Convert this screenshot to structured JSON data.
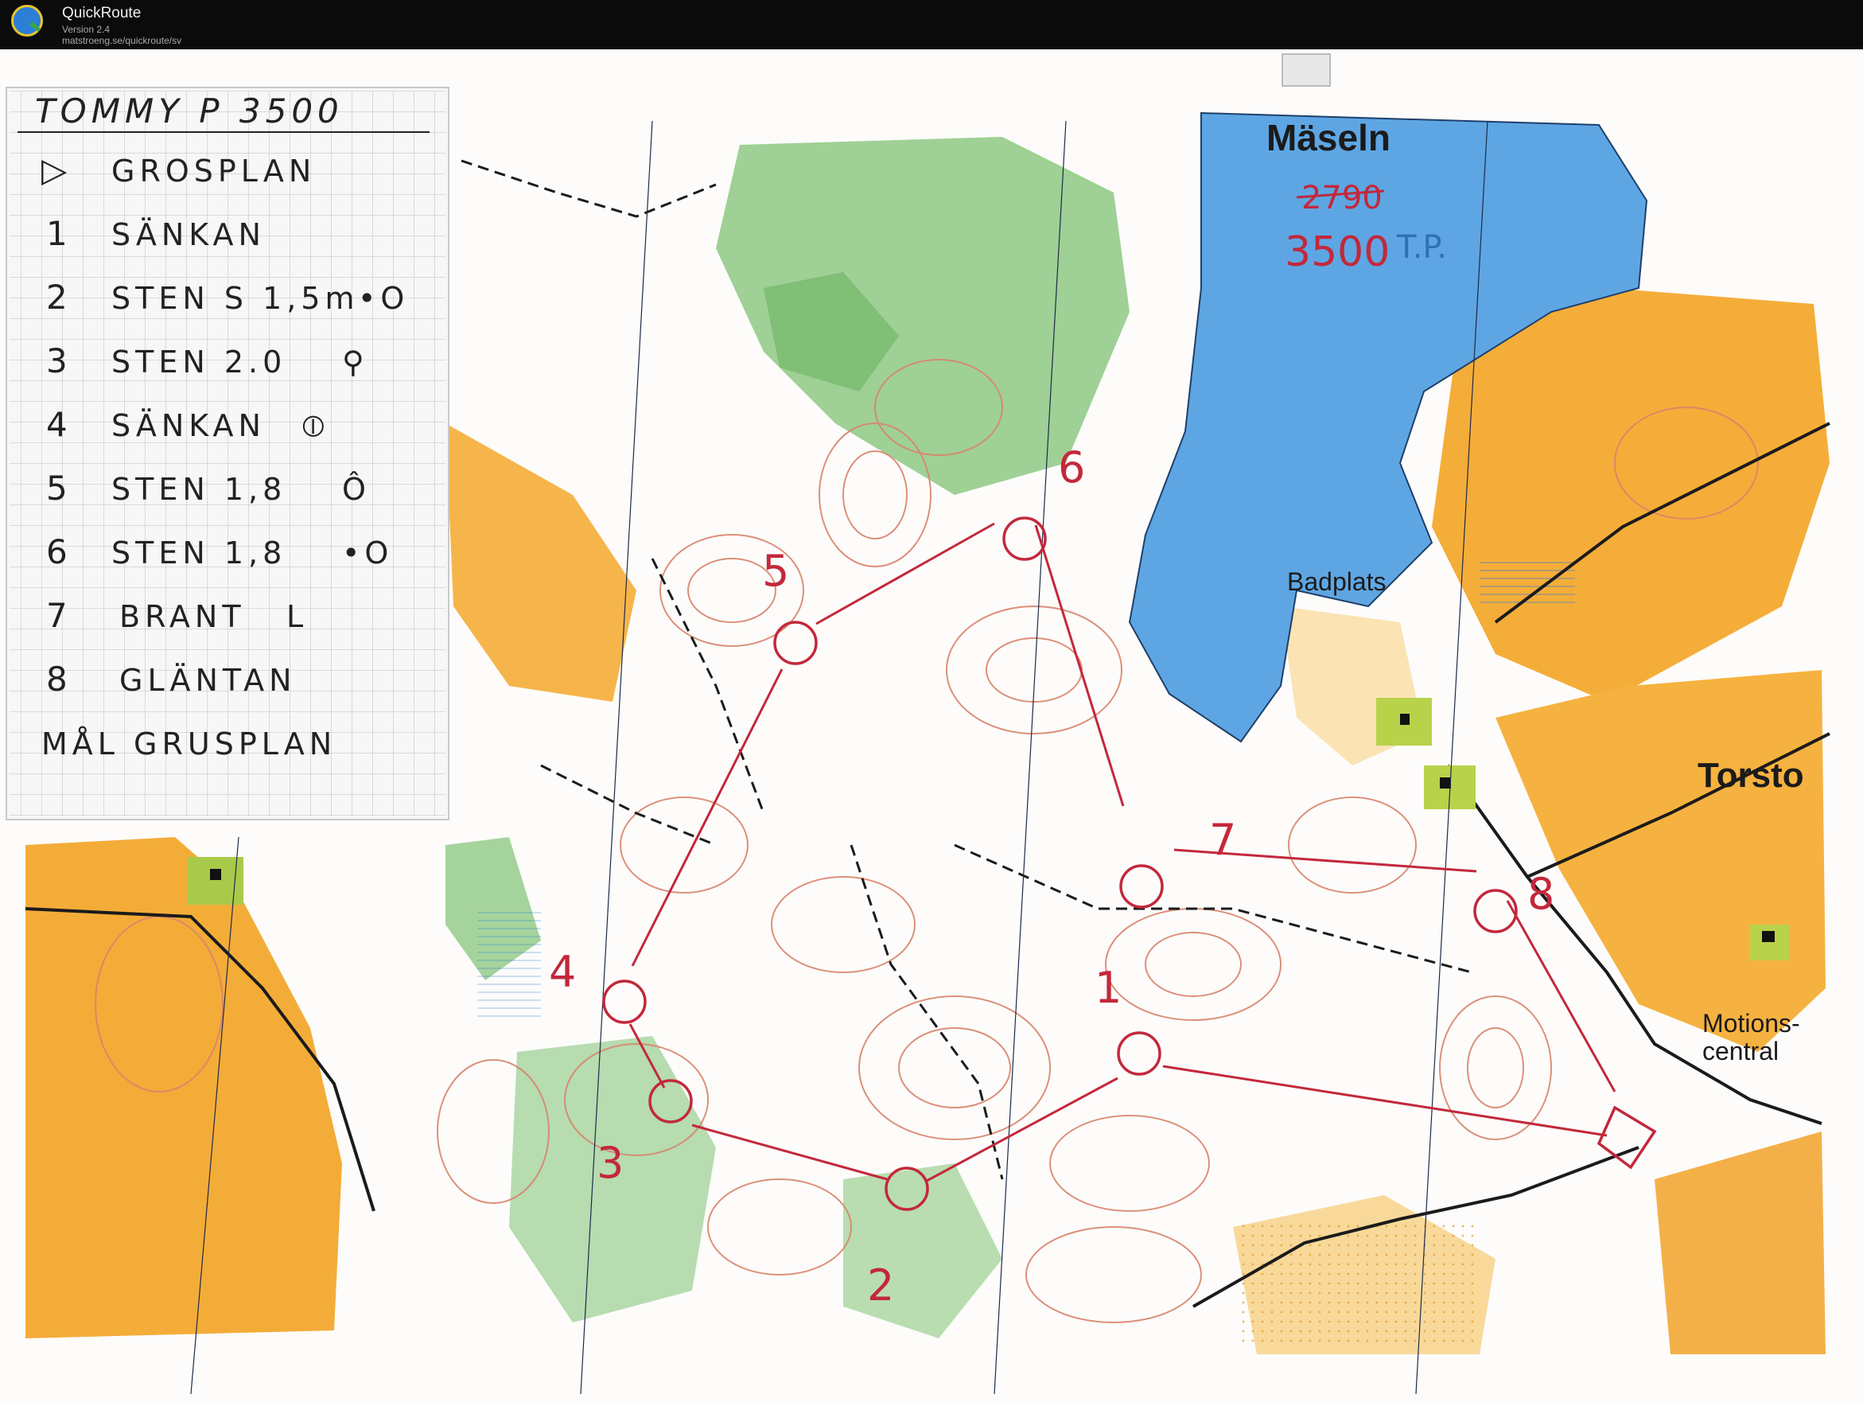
{
  "app": {
    "name": "QuickRoute",
    "version": "Version 2.4",
    "url": "matstroeng.se/quickroute/sv"
  },
  "card": {
    "header": "TOMMY P   3500",
    "rows": [
      {
        "num": "▷",
        "text": "GROSPLAN",
        "sym": ""
      },
      {
        "num": "1",
        "text": "SÄNKAN",
        "sym": ""
      },
      {
        "num": "2",
        "text": "STEN S 1,5m",
        "sym": "•O"
      },
      {
        "num": "3",
        "text": "STEN  2.0",
        "sym": "⚲"
      },
      {
        "num": "4",
        "text": "SÄNKAN",
        "sym": "⦶"
      },
      {
        "num": "5",
        "text": "STEN   1,8",
        "sym": "Ô"
      },
      {
        "num": "6",
        "text": "STEN   1,8",
        "sym": "•O"
      },
      {
        "num": "7",
        "text": "BRANT",
        "sym": "L"
      },
      {
        "num": "8",
        "text": "GLÄNTAN",
        "sym": ""
      }
    ],
    "footer": "MÅL GRUSPLAN"
  },
  "map": {
    "lake_name": "Mäseln",
    "old_length": "2790",
    "new_length": "3500",
    "initials": "T.P.",
    "badplats": "Badplats",
    "torsto": "Torsto",
    "motion_1": "Motions-",
    "motion_2": "central",
    "control_numbers": [
      "1",
      "2",
      "3",
      "4",
      "5",
      "6",
      "7",
      "8"
    ]
  },
  "colors": {
    "lake": "#5ea6e3",
    "open_land": "#f5b03a",
    "green": "#8fc98a",
    "course": "#c3283b",
    "contour": "#d9846b"
  }
}
